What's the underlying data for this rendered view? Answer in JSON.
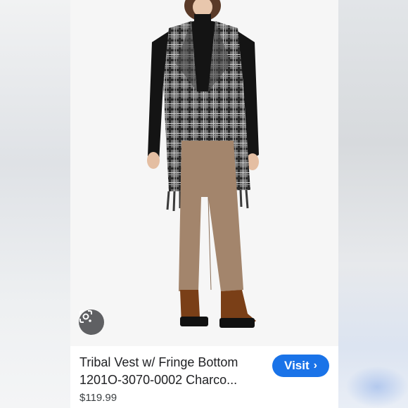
{
  "product": {
    "title_line1": "Tribal Vest w/ Fringe Bottom",
    "title_line2": "1201O-3070-0002 Charco...",
    "price": "$119.99"
  },
  "actions": {
    "visit_label": "Visit",
    "visit_chevron": "›"
  },
  "icons": {
    "lens": "google-lens-icon",
    "chevron": "chevron-right-icon"
  },
  "colors": {
    "visit_button": "#1a73e8",
    "lens_button": "#5f6063"
  }
}
